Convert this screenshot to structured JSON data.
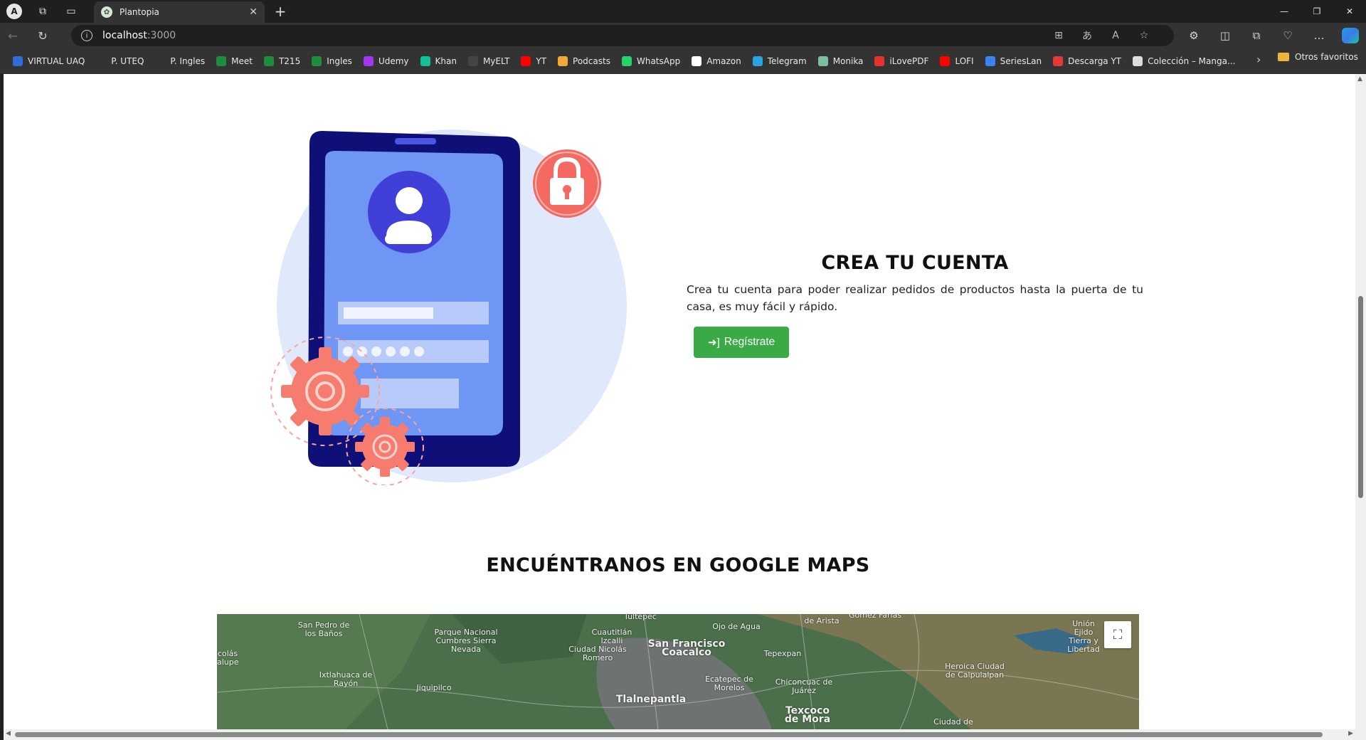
{
  "browser": {
    "tab_title": "Plantopia",
    "url_host": "localhost",
    "url_port": ":3000",
    "bookmarks": [
      {
        "label": "VIRTUAL UAQ",
        "icon": "uaq-icon",
        "color": "#2d6fd6"
      },
      {
        "label": "P. UTEQ",
        "icon": "page-icon",
        "color": "#333333"
      },
      {
        "label": "P. Ingles",
        "icon": "page-icon",
        "color": "#333333"
      },
      {
        "label": "Meet",
        "icon": "meet-icon",
        "color": "#1e8e3e"
      },
      {
        "label": "T215",
        "icon": "classroom-icon",
        "color": "#1e8e3e"
      },
      {
        "label": "Ingles",
        "icon": "classroom-icon",
        "color": "#1e8e3e"
      },
      {
        "label": "Udemy",
        "icon": "udemy-icon",
        "color": "#a435f0"
      },
      {
        "label": "Khan",
        "icon": "khan-icon",
        "color": "#14bf96"
      },
      {
        "label": "MyELT",
        "icon": "myelt-icon",
        "color": "#444444"
      },
      {
        "label": "YT",
        "icon": "youtube-icon",
        "color": "#ff0000"
      },
      {
        "label": "Podcasts",
        "icon": "podcasts-icon",
        "color": "#f2a93b"
      },
      {
        "label": "WhatsApp",
        "icon": "whatsapp-icon",
        "color": "#25d366"
      },
      {
        "label": "Amazon",
        "icon": "amazon-icon",
        "color": "#ffffff"
      },
      {
        "label": "Telegram",
        "icon": "telegram-icon",
        "color": "#2aa3df"
      },
      {
        "label": "Monika",
        "icon": "monika-icon",
        "color": "#7bbf9e"
      },
      {
        "label": "iLovePDF",
        "icon": "ilovepdf-icon",
        "color": "#e5322d"
      },
      {
        "label": "LOFI",
        "icon": "youtube-icon",
        "color": "#ff0000"
      },
      {
        "label": "SeriesLan",
        "icon": "serieslan-icon",
        "color": "#3b82f6"
      },
      {
        "label": "Descarga YT",
        "icon": "download-icon",
        "color": "#e53935"
      },
      {
        "label": "Colección – Manga...",
        "icon": "manga-icon",
        "color": "#dddddd"
      }
    ],
    "other_favorites": "Otros favoritos"
  },
  "cta": {
    "title": "CREA TU CUENTA",
    "description": "Crea tu cuenta para poder realizar pedidos de productos hasta la puerta de tu casa, es muy fácil y rápido.",
    "button_label": "Regístrate"
  },
  "maps": {
    "title": "ENCUÉNTRANOS EN GOOGLE MAPS",
    "labels": {
      "l1": "San Pedro de los Baños",
      "l2": "Parque Nacional Cumbres Sierra Nevada",
      "l3": "Cuautitlán Izcalli",
      "l4": "Tultepec",
      "l5": "Ojo de Agua",
      "l6": "San Francisco Coacalco",
      "l7": "Ciudad Nicolás Romero",
      "l8": "Tepexpan",
      "l9": "Ixtlahuaca de Rayón",
      "l10": "Jiquipilco",
      "l11": "Ecatepec de Morelos",
      "l12": "Chiconcuac de Juárez",
      "l13": "Heroica Ciudad de Calpulalpan",
      "l14": "Tlalnepantla",
      "l15": "Texcoco de Mora",
      "l16": "Ciudad de",
      "l17": "Unión Ejido Tierra y Libertad",
      "l18": "colás alupe",
      "l19": "Gómez Farías",
      "l20": "de Arista"
    }
  },
  "colors": {
    "accent_green": "#3aaa47",
    "phone_dark": "#0f0f78",
    "screen_blue": "#6f96f4",
    "lock_red": "#f46a63",
    "gear_salmon": "#f57c6e",
    "blob_light": "#e0e9fb"
  }
}
